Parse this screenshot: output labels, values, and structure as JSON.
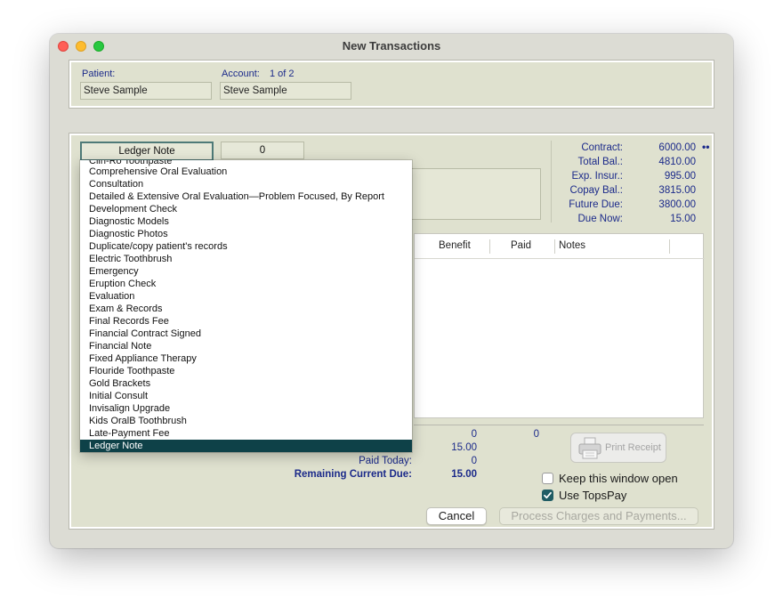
{
  "window": {
    "title": "New Transactions"
  },
  "patient": {
    "patient_label": "Patient:",
    "patient_value": "Steve Sample",
    "account_label": "Account:",
    "account_count": "1 of 2",
    "account_value": "Steve Sample"
  },
  "entry": {
    "selected_type": "Ledger Note",
    "quantity": "0"
  },
  "summary": {
    "rows": [
      {
        "label": "Contract:",
        "value": "6000.00"
      },
      {
        "label": "Total Bal.:",
        "value": "4810.00"
      },
      {
        "label": "Exp. Insur.:",
        "value": "995.00"
      },
      {
        "label": "Copay Bal.:",
        "value": "3815.00"
      },
      {
        "label": "Future Due:",
        "value": "3800.00"
      },
      {
        "label": "Due Now:",
        "value": "15.00"
      }
    ],
    "more_glyph": "••"
  },
  "table": {
    "columns": [
      "Benefit",
      "Paid",
      "Notes"
    ]
  },
  "totals": {
    "row1_a": "0",
    "row1_b": "0",
    "row2": "15.00",
    "paid_today_label": "Paid Today:",
    "paid_today_value": "0",
    "remaining_label": "Remaining Current Due:",
    "remaining_value": "15.00"
  },
  "actions": {
    "print_receipt": "Print Receipt",
    "keep_open_label": "Keep this window open",
    "keep_open_checked": false,
    "use_topspay_label": "Use TopsPay",
    "use_topspay_checked": true,
    "cancel_label": "Cancel",
    "process_label": "Process Charges and Payments..."
  },
  "dropdown": {
    "partial_item": "Clin-Ro Toothpaste",
    "items": [
      "Comprehensive Oral Evaluation",
      "Consultation",
      "Detailed & Extensive Oral Evaluation—Problem Focused, By Report",
      "Development Check",
      "Diagnostic Models",
      "Diagnostic Photos",
      "Duplicate/copy patient's records",
      "Electric Toothbrush",
      "Emergency",
      "Eruption Check",
      "Evaluation",
      "Exam & Records",
      "Final Records Fee",
      "Financial Contract Signed",
      "Financial Note",
      "Fixed Appliance Therapy",
      "Flouride Toothpaste",
      "Gold Brackets",
      "Initial Consult",
      "Invisalign Upgrade",
      "Kids OralB Toothbrush",
      "Late-Payment Fee",
      "Ledger Note"
    ],
    "selected": "Ledger Note"
  },
  "colors": {
    "panel_bg": "#dfe1cf",
    "label_blue": "#1b2a8a",
    "selection": "#0e4148"
  }
}
